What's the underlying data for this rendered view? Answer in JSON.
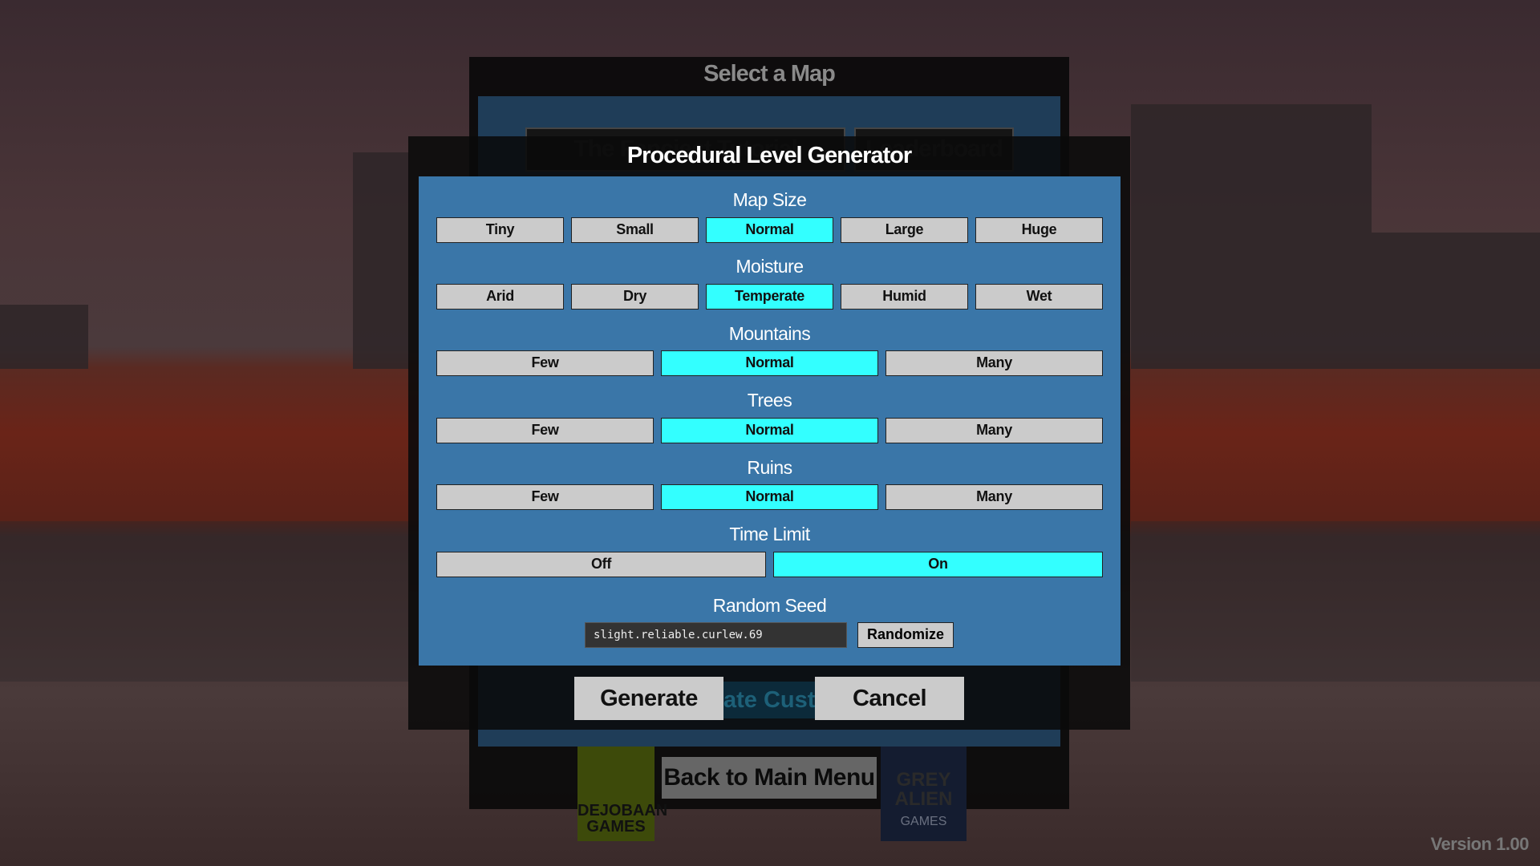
{
  "background_dialog": {
    "title": "Select a Map",
    "tabs": [
      "The Fanciest Tutorial",
      "Leaderboard"
    ],
    "obscured_button": "ate Custo",
    "back_button": "Back to Main Menu"
  },
  "dialog": {
    "title": "Procedural Level Generator",
    "groups": [
      {
        "label": "Map Size",
        "options": [
          "Tiny",
          "Small",
          "Normal",
          "Large",
          "Huge"
        ],
        "selected": "Normal"
      },
      {
        "label": "Moisture",
        "options": [
          "Arid",
          "Dry",
          "Temperate",
          "Humid",
          "Wet"
        ],
        "selected": "Temperate"
      },
      {
        "label": "Mountains",
        "options": [
          "Few",
          "Normal",
          "Many"
        ],
        "selected": "Normal"
      },
      {
        "label": "Trees",
        "options": [
          "Few",
          "Normal",
          "Many"
        ],
        "selected": "Normal"
      },
      {
        "label": "Ruins",
        "options": [
          "Few",
          "Normal",
          "Many"
        ],
        "selected": "Normal"
      },
      {
        "label": "Time Limit",
        "options": [
          "Off",
          "On"
        ],
        "selected": "On"
      }
    ],
    "seed_label": "Random Seed",
    "seed_value": "slight.reliable.curlew.69",
    "randomize_label": "Randomize",
    "generate_label": "Generate",
    "cancel_label": "Cancel"
  },
  "logos": {
    "left": "DEJOBAAN GAMES",
    "right_top": "GREY ALIEN",
    "right_bottom": "GAMES"
  },
  "version": "Version 1.00",
  "colors": {
    "panel": "#3a76a8",
    "selected": "#33ffff",
    "button": "#cbcbcb"
  }
}
